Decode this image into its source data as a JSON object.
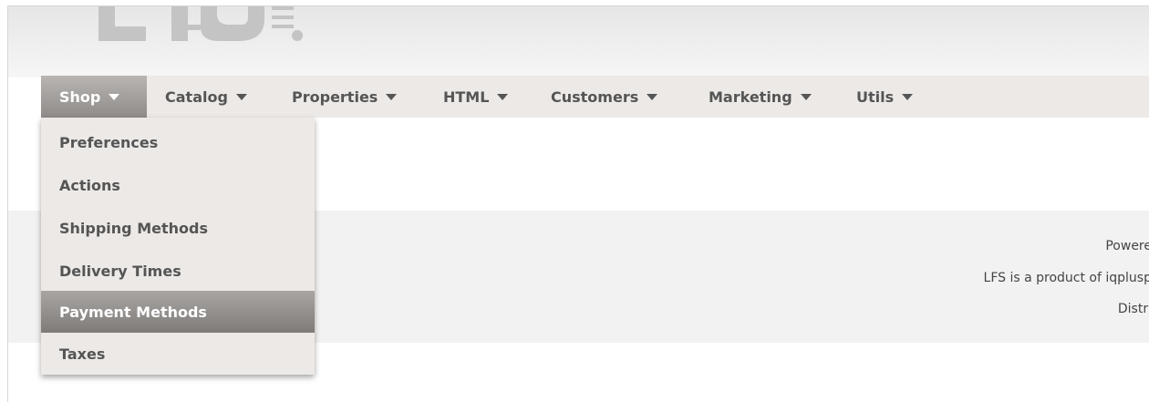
{
  "logo": {
    "text": "LFS",
    "alt": "lfs-logo"
  },
  "nav": {
    "items": [
      {
        "label": "Shop",
        "active": true
      },
      {
        "label": "Catalog",
        "active": false
      },
      {
        "label": "Properties",
        "active": false
      },
      {
        "label": "HTML",
        "active": false
      },
      {
        "label": "Customers",
        "active": false
      },
      {
        "label": "Marketing",
        "active": false
      },
      {
        "label": "Utils",
        "active": false
      }
    ]
  },
  "dropdown": {
    "items": [
      {
        "label": "Preferences",
        "highlighted": false
      },
      {
        "label": "Actions",
        "highlighted": false
      },
      {
        "label": "Shipping Methods",
        "highlighted": false
      },
      {
        "label": "Delivery Times",
        "highlighted": false
      },
      {
        "label": "Payment Methods",
        "highlighted": true
      },
      {
        "label": "Taxes",
        "highlighted": false
      }
    ]
  },
  "footer": {
    "line1": "Powere",
    "line2": "LFS is a product of iqplusp",
    "line3": "Distri"
  },
  "colors": {
    "nav_bg": "#ece9e7",
    "nav_text": "#555555",
    "active_bg": "#8f8b89",
    "highlight_bg": "#7f7b79",
    "band_bg": "#f3f2f2"
  }
}
